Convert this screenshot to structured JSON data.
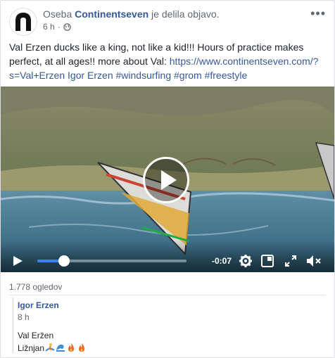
{
  "header": {
    "prefix": "Oseba",
    "page_name": "Continentseven",
    "action": "je delila objavo.",
    "time": "6 h",
    "separator": "·",
    "audience_icon": "globe-icon",
    "more_icon": "more-options-icon"
  },
  "post": {
    "text_before_link": "Val Erzen ducks like a king, not like a kid!!! Hours of practice makes perfect, at all ages!! more about Val:",
    "link": "https://www.continentseven.com/?s=Val+Erzen",
    "hashtags": [
      "Igor Erzen",
      "#windsurfing",
      "#grom",
      "#freestyle"
    ]
  },
  "video": {
    "play_icon": "play-icon",
    "controls_play_icon": "play-icon",
    "progress": 0.18,
    "remaining_time": "-0:07",
    "settings_icon": "gear-icon",
    "pip_icon": "picture-in-picture-icon",
    "fullscreen_icon": "fullscreen-icon",
    "volume_icon": "volume-icon"
  },
  "stats": {
    "views": "1.778 ogledov"
  },
  "shared_comment": {
    "author": "Igor Erzen",
    "time": "8 h",
    "line1": "Val Eržen",
    "line2_text": "Ližnjan",
    "emojis": [
      "surfer",
      "wave",
      "fire",
      "fire"
    ]
  },
  "colors": {
    "link": "#365899",
    "text": "#1d2129",
    "meta": "#616770",
    "progress_fill": "#4080ff"
  }
}
